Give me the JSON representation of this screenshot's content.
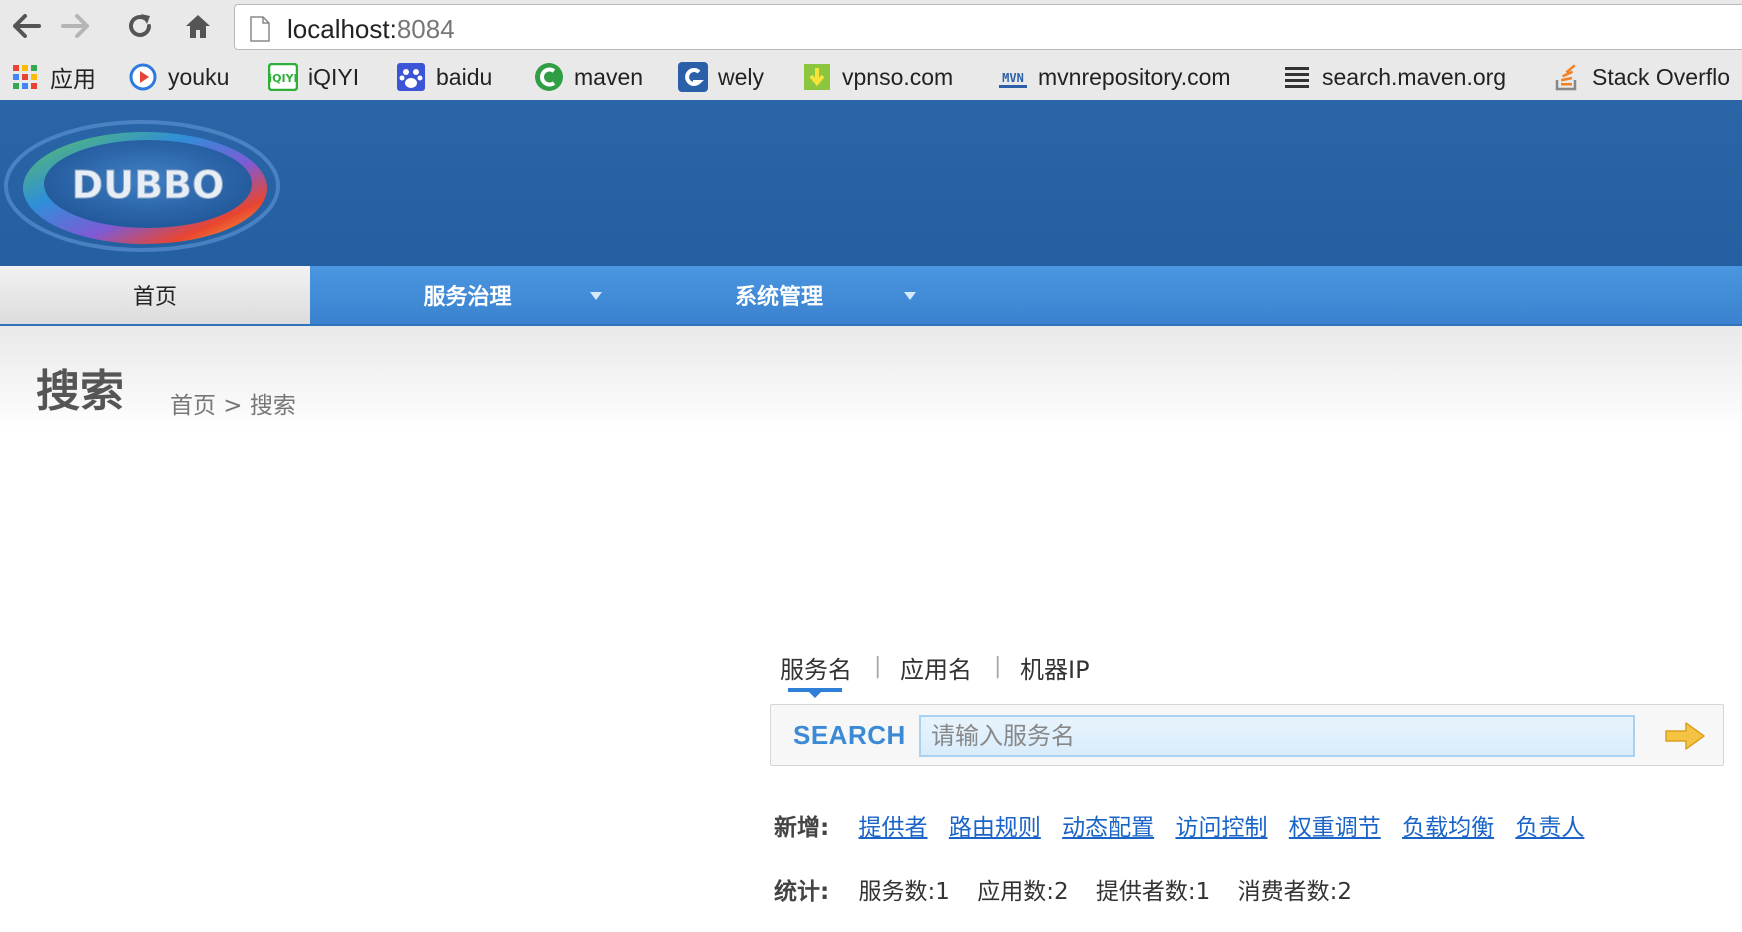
{
  "browser": {
    "url_host": "localhost:",
    "url_port": "8084",
    "bookmarks": [
      {
        "label": "应用",
        "icon": "apps-grid-icon"
      },
      {
        "label": "youku",
        "icon": "youku-icon"
      },
      {
        "label": "iQIYI",
        "icon": "iqiyi-icon"
      },
      {
        "label": "baidu",
        "icon": "baidu-paw-icon"
      },
      {
        "label": "maven",
        "icon": "maven-c-icon"
      },
      {
        "label": "wely",
        "icon": "wely-icon"
      },
      {
        "label": "vpnso.com",
        "icon": "vpnso-icon"
      },
      {
        "label": "mvnrepository.com",
        "icon": "mvn-icon"
      },
      {
        "label": "search.maven.org",
        "icon": "lines-icon"
      },
      {
        "label": "Stack Overflo",
        "icon": "stackoverflow-icon"
      }
    ]
  },
  "app": {
    "logo_text": "DUBBO"
  },
  "nav": {
    "items": [
      {
        "label": "首页"
      },
      {
        "label": "服务治理"
      },
      {
        "label": "系统管理"
      }
    ]
  },
  "page": {
    "title": "搜索",
    "breadcrumb": "首页 > 搜索"
  },
  "search": {
    "tabs": [
      "服务名",
      "应用名",
      "机器IP"
    ],
    "separator": "|",
    "label": "SEARCH",
    "placeholder": "请输入服务名",
    "value": ""
  },
  "add": {
    "label": "新增:",
    "links": [
      "提供者",
      "路由规则",
      "动态配置",
      "访问控制",
      "权重调节",
      "负载均衡",
      "负责人"
    ]
  },
  "stats": {
    "label": "统计:",
    "items": [
      "服务数:1",
      "应用数:2",
      "提供者数:1",
      "消费者数:2"
    ]
  },
  "colors": {
    "header_blue": "#2a66a7",
    "nav_blue": "#4b96e0",
    "link_blue": "#1a64c8",
    "search_label": "#3a8ad6",
    "arrow_yellow": "#f5c342"
  }
}
